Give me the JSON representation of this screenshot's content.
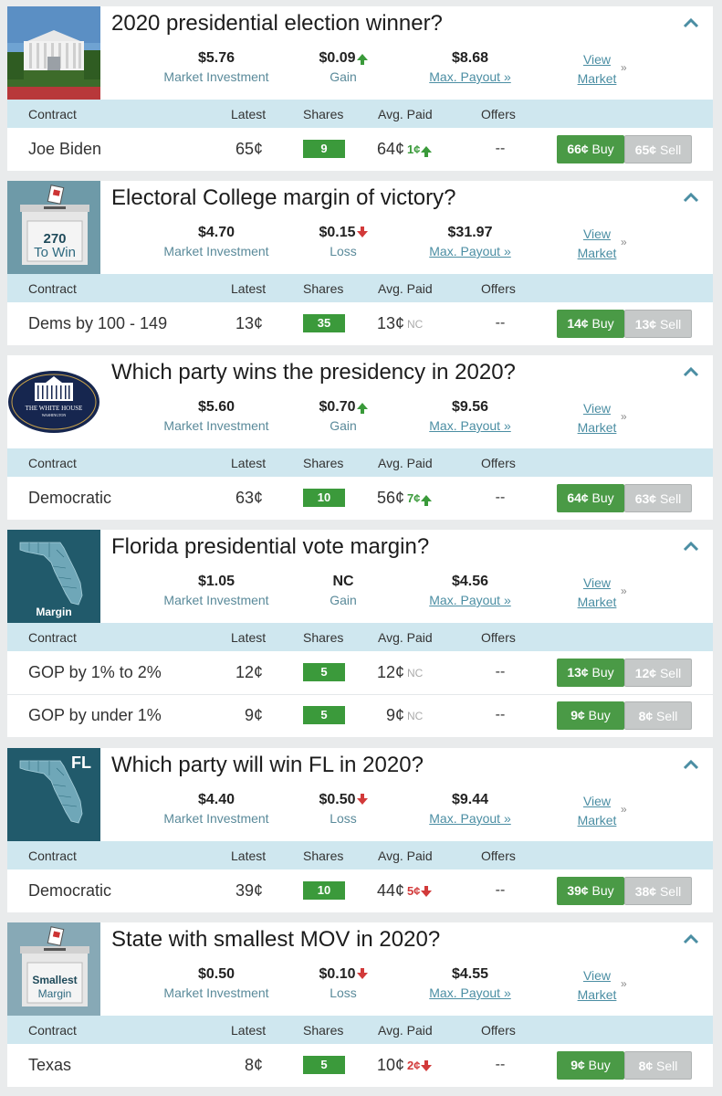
{
  "header_labels": {
    "contract": "Contract",
    "latest": "Latest",
    "shares": "Shares",
    "avg_paid": "Avg. Paid",
    "offers": "Offers"
  },
  "stat_labels": {
    "investment": "Market Investment",
    "payout": "Max. Payout »"
  },
  "view_market": {
    "line1": "View",
    "line2": "Market",
    "chevron": "»"
  },
  "buy_suffix": " Buy",
  "sell_suffix": " Sell",
  "markets": [
    {
      "title": "2020 presidential election winner?",
      "investment": "$5.76",
      "gain": "$0.09",
      "gain_label": "Gain",
      "gain_dir": "up",
      "payout": "$8.68",
      "thumb": "white-house-photo",
      "rows": [
        {
          "name": "Joe Biden",
          "latest": "65¢",
          "shares": "9",
          "avg": "64¢",
          "chg": "1¢",
          "chg_dir": "up",
          "offers": "--",
          "buy": "66¢",
          "sell": "65¢"
        }
      ]
    },
    {
      "title": "Electoral College margin of victory?",
      "investment": "$4.70",
      "gain": "$0.15",
      "gain_label": "Loss",
      "gain_dir": "down",
      "payout": "$31.97",
      "thumb": "ballot-box-270",
      "thumb_text": {
        "line1": "270",
        "line2": "To Win"
      },
      "rows": [
        {
          "name": "Dems by 100 - 149",
          "latest": "13¢",
          "shares": "35",
          "avg": "13¢",
          "chg": "NC",
          "chg_dir": "nc",
          "offers": "--",
          "buy": "14¢",
          "sell": "13¢"
        }
      ]
    },
    {
      "title": "Which party wins the presidency in 2020?",
      "investment": "$5.60",
      "gain": "$0.70",
      "gain_label": "Gain",
      "gain_dir": "up",
      "payout": "$9.56",
      "thumb": "white-house-seal",
      "thumb_text": {
        "line1": "THE WHITE HOUSE",
        "line2": "WASHINGTON"
      },
      "rows": [
        {
          "name": "Democratic",
          "latest": "63¢",
          "shares": "10",
          "avg": "56¢",
          "chg": "7¢",
          "chg_dir": "up",
          "offers": "--",
          "buy": "64¢",
          "sell": "63¢"
        }
      ]
    },
    {
      "title": "Florida presidential vote margin?",
      "investment": "$1.05",
      "gain": "NC",
      "gain_label": "Gain",
      "gain_dir": "none",
      "payout": "$4.56",
      "thumb": "florida-map-margin",
      "thumb_text": {
        "line1": "Margin"
      },
      "rows": [
        {
          "name": "GOP by 1% to 2%",
          "latest": "12¢",
          "shares": "5",
          "avg": "12¢",
          "chg": "NC",
          "chg_dir": "nc",
          "offers": "--",
          "buy": "13¢",
          "sell": "12¢"
        },
        {
          "name": "GOP by under 1%",
          "latest": "9¢",
          "shares": "5",
          "avg": "9¢",
          "chg": "NC",
          "chg_dir": "nc",
          "offers": "--",
          "buy": "9¢",
          "sell": "8¢"
        }
      ]
    },
    {
      "title": "Which party will win FL in 2020?",
      "investment": "$4.40",
      "gain": "$0.50",
      "gain_label": "Loss",
      "gain_dir": "down",
      "payout": "$9.44",
      "thumb": "florida-map-fl",
      "thumb_text": {
        "line1": "FL"
      },
      "rows": [
        {
          "name": "Democratic",
          "latest": "39¢",
          "shares": "10",
          "avg": "44¢",
          "chg": "5¢",
          "chg_dir": "down",
          "offers": "--",
          "buy": "39¢",
          "sell": "38¢"
        }
      ]
    },
    {
      "title": "State with smallest MOV in 2020?",
      "investment": "$0.50",
      "gain": "$0.10",
      "gain_label": "Loss",
      "gain_dir": "down",
      "payout": "$4.55",
      "thumb": "ballot-box-smallest",
      "thumb_text": {
        "line1": "Smallest",
        "line2": "Margin"
      },
      "rows": [
        {
          "name": "Texas",
          "latest": "8¢",
          "shares": "5",
          "avg": "10¢",
          "chg": "2¢",
          "chg_dir": "down",
          "offers": "--",
          "buy": "9¢",
          "sell": "8¢"
        }
      ]
    }
  ]
}
